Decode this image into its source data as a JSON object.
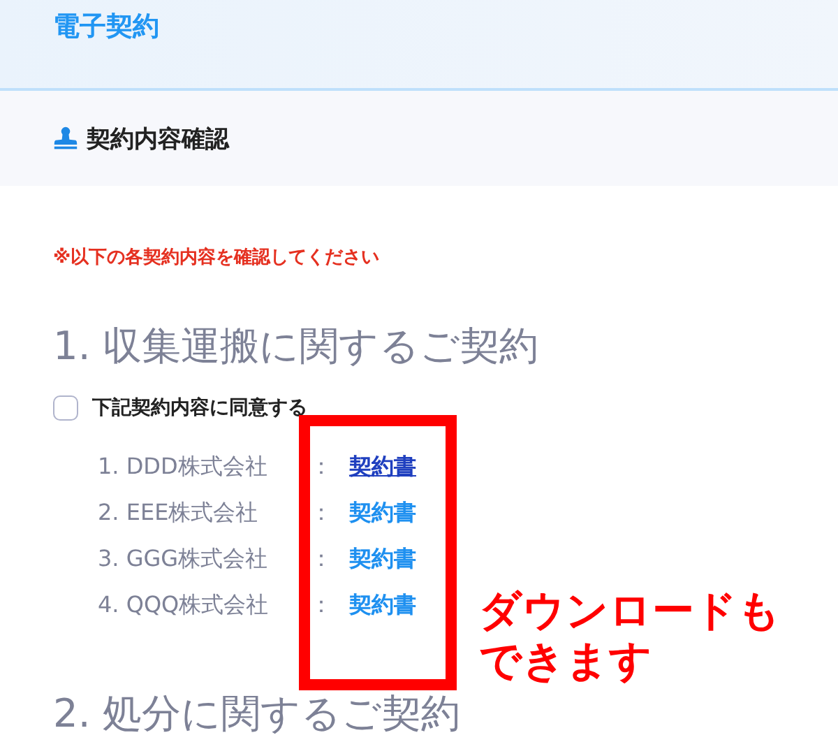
{
  "header": {
    "title": "電子契約"
  },
  "section": {
    "title": "契約内容確認"
  },
  "notice": "※以下の各契約内容を確認してください",
  "groups": [
    {
      "heading": "1. 収集運搬に関するご契約",
      "agree": {
        "label": "下記契約内容に同意する",
        "checked": false
      },
      "items": [
        {
          "label": "1. DDD株式会社",
          "separator": "：",
          "link": "契約書",
          "hovered": true
        },
        {
          "label": "2. EEE株式会社",
          "separator": "：",
          "link": "契約書",
          "hovered": false
        },
        {
          "label": "3. GGG株式会社",
          "separator": "：",
          "link": "契約書",
          "hovered": false
        },
        {
          "label": "4. QQQ株式会社",
          "separator": "：",
          "link": "契約書",
          "hovered": false
        }
      ]
    },
    {
      "heading": "2. 処分に関するご契約"
    }
  ],
  "annotation": {
    "lines": [
      "ダウンロードも",
      "できます"
    ]
  }
}
